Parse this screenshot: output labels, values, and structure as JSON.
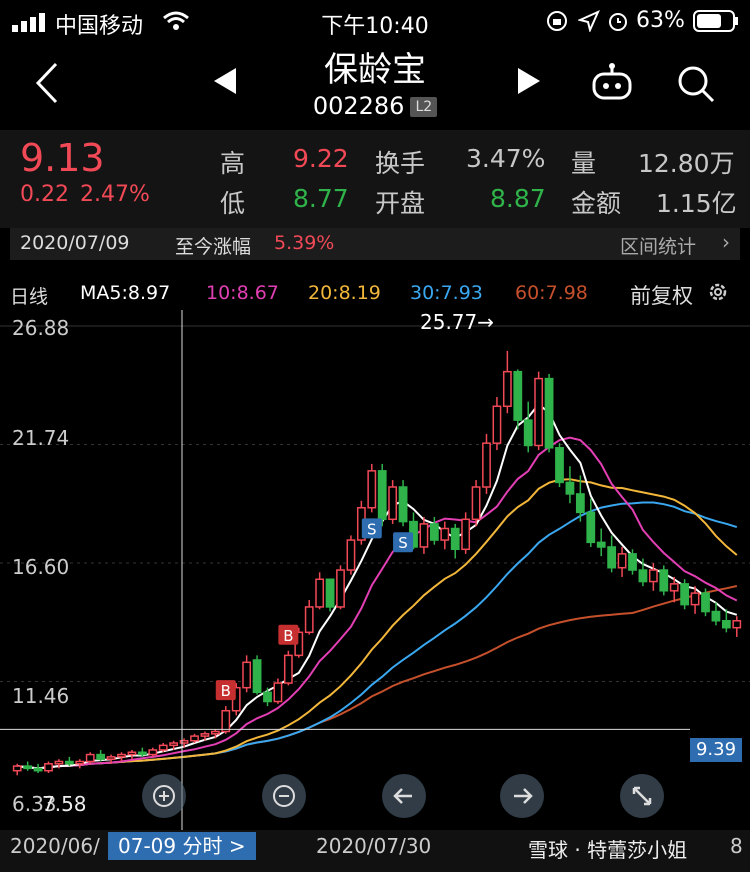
{
  "status": {
    "carrier": "中国移动",
    "time": "下午10:40",
    "battery": "63%"
  },
  "nav": {
    "title": "保龄宝",
    "code": "002286",
    "level": "L2",
    "icons": [
      "back-icon",
      "prev-icon",
      "next-icon",
      "robot-icon",
      "search-icon"
    ]
  },
  "quote": {
    "price": "9.13",
    "change": "0.22",
    "change_pct": "2.47%",
    "high_label": "高",
    "high": "9.22",
    "low_label": "低",
    "low": "8.77",
    "turnover_label": "换手",
    "turnover": "3.47%",
    "open_label": "开盘",
    "open": "8.87",
    "volume_label": "量",
    "volume": "12.80万",
    "amount_label": "金额",
    "amount": "1.15亿"
  },
  "range": {
    "date": "2020/07/09",
    "label": "至今涨幅",
    "value": "5.39%",
    "stats_label": "区间统计"
  },
  "ma": {
    "period": "日线",
    "ma5": "MA5:8.97",
    "ma10": "10:8.67",
    "ma20": "20:8.19",
    "ma30": "30:7.93",
    "ma60": "60:7.98",
    "adjust": "前复权",
    "colors": {
      "ma5": "#ffffff",
      "ma10": "#e33fb4",
      "ma20": "#f2b63a",
      "ma30": "#3aa8f0",
      "ma60": "#c6502c"
    }
  },
  "chart_data": {
    "type": "candlestick",
    "y_ticks": [
      "26.88",
      "21.74",
      "16.60",
      "11.46",
      "6.33"
    ],
    "ylim": [
      6.33,
      26.88
    ],
    "high_annotation": "25.77→",
    "low_annotation": "7.58",
    "crosshair_price": "9.39",
    "candles": [
      [
        7.6,
        7.9,
        7.4,
        7.8
      ],
      [
        7.8,
        8.0,
        7.6,
        7.7
      ],
      [
        7.7,
        7.9,
        7.5,
        7.6
      ],
      [
        7.6,
        8.0,
        7.5,
        7.9
      ],
      [
        7.9,
        8.1,
        7.7,
        8.0
      ],
      [
        8.0,
        8.2,
        7.8,
        7.9
      ],
      [
        7.9,
        8.1,
        7.7,
        8.0
      ],
      [
        8.0,
        8.4,
        7.9,
        8.3
      ],
      [
        8.3,
        8.5,
        8.0,
        8.1
      ],
      [
        8.1,
        8.3,
        7.9,
        8.2
      ],
      [
        8.2,
        8.4,
        8.0,
        8.3
      ],
      [
        8.3,
        8.5,
        8.1,
        8.4
      ],
      [
        8.4,
        8.6,
        8.2,
        8.3
      ],
      [
        8.3,
        8.6,
        8.2,
        8.5
      ],
      [
        8.5,
        8.8,
        8.4,
        8.7
      ],
      [
        8.7,
        8.9,
        8.5,
        8.8
      ],
      [
        8.8,
        9.0,
        8.6,
        8.9
      ],
      [
        8.9,
        9.2,
        8.8,
        9.1
      ],
      [
        9.1,
        9.3,
        8.9,
        9.2
      ],
      [
        9.2,
        9.4,
        9.0,
        9.3
      ],
      [
        9.3,
        10.4,
        9.2,
        10.2
      ],
      [
        10.2,
        11.4,
        10.0,
        11.2
      ],
      [
        11.2,
        12.6,
        11.0,
        12.3
      ],
      [
        12.4,
        12.6,
        10.9,
        11.0
      ],
      [
        11.0,
        11.2,
        10.4,
        10.6
      ],
      [
        10.6,
        11.6,
        10.5,
        11.4
      ],
      [
        11.4,
        12.8,
        11.3,
        12.6
      ],
      [
        12.6,
        13.8,
        12.5,
        13.6
      ],
      [
        13.6,
        15.0,
        13.5,
        14.7
      ],
      [
        14.7,
        16.2,
        14.6,
        15.9
      ],
      [
        15.9,
        15.9,
        14.5,
        14.7
      ],
      [
        14.7,
        16.5,
        14.6,
        16.3
      ],
      [
        16.3,
        17.8,
        16.1,
        17.6
      ],
      [
        17.6,
        19.3,
        17.4,
        19.0
      ],
      [
        19.0,
        20.9,
        18.8,
        20.6
      ],
      [
        20.6,
        20.9,
        18.2,
        18.5
      ],
      [
        18.5,
        20.2,
        18.3,
        19.9
      ],
      [
        19.9,
        20.2,
        18.2,
        18.4
      ],
      [
        18.4,
        18.8,
        17.2,
        17.3
      ],
      [
        17.3,
        18.6,
        17.0,
        18.3
      ],
      [
        18.3,
        18.6,
        17.4,
        17.6
      ],
      [
        17.6,
        18.4,
        17.2,
        18.1
      ],
      [
        18.1,
        18.3,
        16.8,
        17.2
      ],
      [
        17.2,
        18.8,
        17.0,
        18.5
      ],
      [
        18.5,
        20.2,
        18.2,
        19.9
      ],
      [
        19.9,
        22.2,
        19.6,
        21.8
      ],
      [
        21.8,
        23.8,
        21.5,
        23.4
      ],
      [
        23.4,
        25.8,
        23.1,
        24.9
      ],
      [
        24.9,
        25.0,
        22.4,
        22.8
      ],
      [
        22.8,
        23.6,
        21.4,
        21.7
      ],
      [
        21.7,
        24.9,
        21.5,
        24.6
      ],
      [
        24.6,
        24.8,
        21.4,
        21.6
      ],
      [
        21.6,
        21.8,
        19.9,
        20.1
      ],
      [
        20.1,
        20.8,
        19.2,
        19.6
      ],
      [
        19.6,
        20.4,
        18.4,
        18.8
      ],
      [
        18.8,
        19.4,
        17.3,
        17.5
      ],
      [
        17.5,
        18.1,
        16.9,
        17.3
      ],
      [
        17.3,
        17.8,
        16.2,
        16.4
      ],
      [
        16.4,
        17.3,
        16.0,
        17.0
      ],
      [
        17.0,
        17.2,
        16.1,
        16.3
      ],
      [
        16.3,
        16.8,
        15.6,
        15.8
      ],
      [
        15.8,
        16.6,
        15.4,
        16.3
      ],
      [
        16.3,
        16.5,
        15.2,
        15.4
      ],
      [
        15.4,
        16.0,
        14.9,
        15.7
      ],
      [
        15.7,
        15.9,
        14.6,
        14.8
      ],
      [
        14.8,
        15.6,
        14.4,
        15.3
      ],
      [
        15.3,
        15.5,
        14.3,
        14.5
      ],
      [
        14.5,
        14.9,
        13.9,
        14.1
      ],
      [
        14.1,
        14.6,
        13.6,
        13.8
      ],
      [
        13.8,
        14.3,
        13.4,
        14.1
      ]
    ],
    "markers": [
      {
        "label": "B",
        "index": 26,
        "type": "buy"
      },
      {
        "label": "S",
        "index": 34,
        "type": "sell"
      },
      {
        "label": "S",
        "index": 37,
        "type": "sell"
      },
      {
        "label": "B",
        "index": 20,
        "type": "buy"
      }
    ],
    "x_ticks": [
      "2020/06/",
      "2020/07/30",
      "8"
    ],
    "x_highlight": "07-09 分时 >"
  },
  "toolbar": {
    "icons": [
      "zoom-in-icon",
      "zoom-out-icon",
      "left-arrow-icon",
      "right-arrow-icon",
      "fullscreen-icon"
    ]
  },
  "watermark": "雪球 · 特蕾莎小姐"
}
